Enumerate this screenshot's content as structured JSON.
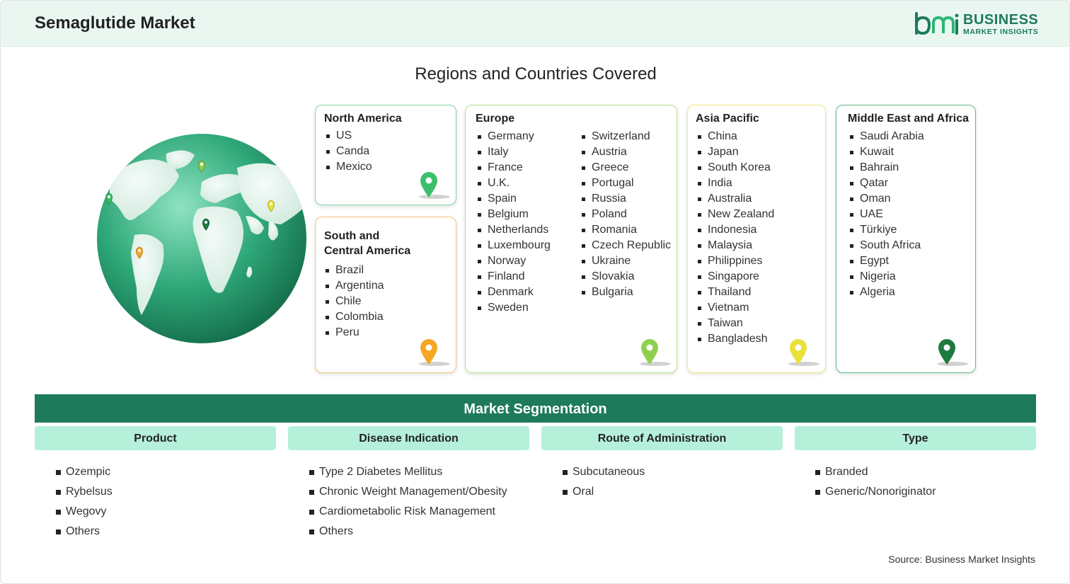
{
  "header": {
    "title": "Semaglutide Market",
    "logo": {
      "brand_line1": "BUSINESS",
      "brand_line2": "MARKET INSIGHTS",
      "mark": "bmi"
    }
  },
  "section_title": "Regions and Countries Covered",
  "regions": {
    "north_america": {
      "title": "North America",
      "items": [
        "US",
        "Canda",
        "Mexico"
      ],
      "color": "#3bbf6a"
    },
    "south_central_america": {
      "title_line1": "South and",
      "title_line2": "Central America",
      "items": [
        "Brazil",
        "Argentina",
        "Chile",
        "Colombia",
        "Peru"
      ],
      "color": "#f5a623"
    },
    "europe": {
      "title": "Europe",
      "col1": [
        "Germany",
        "Italy",
        "France",
        "U.K.",
        "Spain",
        "Belgium",
        "Netherlands",
        "Luxembourg",
        "Norway",
        "Finland",
        "Denmark",
        "Sweden"
      ],
      "col2": [
        "Switzerland",
        "Austria",
        "Greece",
        "Portugal",
        "Russia",
        "Poland",
        "Romania",
        "Czech Republic",
        "Ukraine",
        "Slovakia",
        "Bulgaria"
      ],
      "color": "#8fd14f"
    },
    "asia_pacific": {
      "title": "Asia Pacific",
      "items": [
        "China",
        "Japan",
        "South Korea",
        "India",
        "Australia",
        "New Zealand",
        "Indonesia",
        "Malaysia",
        "Philippines",
        "Singapore",
        "Thailand",
        "Vietnam",
        "Taiwan",
        "Bangladesh"
      ],
      "color": "#e8e13a"
    },
    "middle_east_africa": {
      "title": "Middle East and Africa",
      "items": [
        "Saudi Arabia",
        "Kuwait",
        "Bahrain",
        "Qatar",
        "Oman",
        "UAE",
        "Türkiye",
        "South Africa",
        "Egypt",
        "Nigeria",
        "Algeria"
      ],
      "color": "#1d7a3e"
    }
  },
  "segmentation": {
    "title": "Market Segmentation",
    "columns": [
      {
        "heading": "Product",
        "items": [
          "Ozempic",
          "Rybelsus",
          "Wegovy",
          "Others"
        ]
      },
      {
        "heading": "Disease Indication",
        "items": [
          "Type 2 Diabetes Mellitus",
          "Chronic Weight Management/Obesity",
          "Cardiometabolic Risk Management",
          "Others"
        ]
      },
      {
        "heading": "Route of Administration",
        "items": [
          "Subcutaneous",
          "Oral"
        ]
      },
      {
        "heading": "Type",
        "items": [
          "Branded",
          "Generic/Nonoriginator"
        ]
      }
    ]
  },
  "source": "Source: Business Market Insights",
  "colors": {
    "primary_green": "#1d7a5b",
    "segment_header": "#b5f0da",
    "header_bg": "#eaf7f1"
  }
}
